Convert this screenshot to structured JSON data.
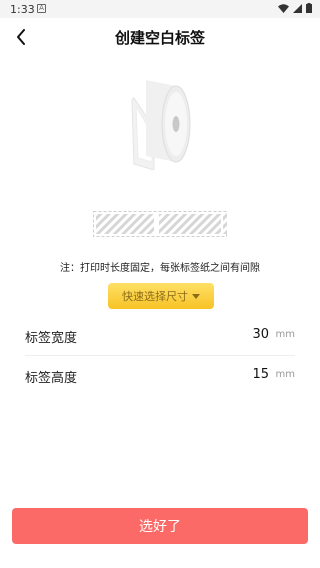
{
  "status_bar": {
    "time": "1:33",
    "notification_icon": "a-box-icon",
    "wifi_icon": "wifi-icon",
    "signal_icon": "signal-icon",
    "battery_icon": "battery-icon"
  },
  "header": {
    "back_icon": "chevron-left-icon",
    "title": "创建空白标签"
  },
  "illustration": {
    "roll_icon": "label-roll-icon",
    "strip_icon": "label-strip-icon"
  },
  "note": "注：打印时长度固定，每张标签纸之间有间隙",
  "quick_select": {
    "label": "快速选择尺寸",
    "accent": "#f7c326"
  },
  "fields": {
    "width": {
      "label": "标签宽度",
      "value": "30",
      "unit": "mm"
    },
    "height": {
      "label": "标签高度",
      "value": "15",
      "unit": "mm"
    }
  },
  "confirm_button": {
    "label": "选好了",
    "color": "#fb6a66"
  }
}
